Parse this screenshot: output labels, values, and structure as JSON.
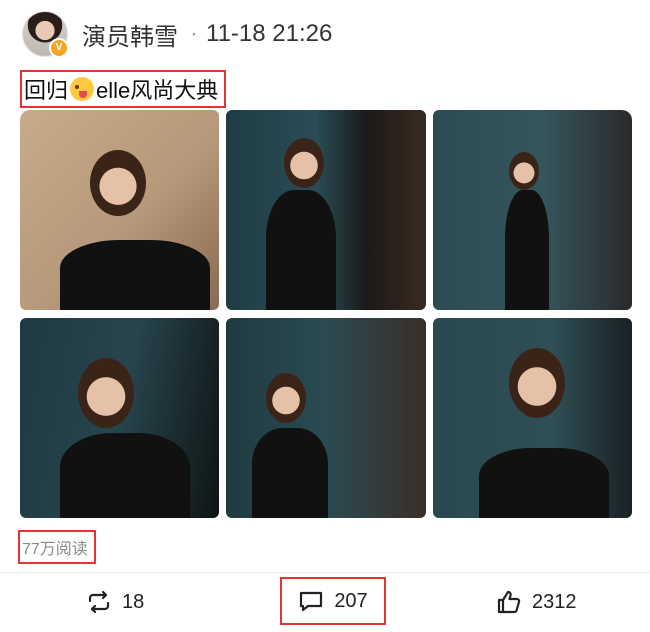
{
  "post": {
    "author": "演员韩雪",
    "verified_badge": "V",
    "separator": "·",
    "time": "11-18 21:26",
    "text_before_emoji": "回归",
    "emoji": "tongue-wink-emoji",
    "text_after_emoji": "elle风尚大典",
    "reads": "77万阅读"
  },
  "photos": [
    {
      "name": "photo-1"
    },
    {
      "name": "photo-2"
    },
    {
      "name": "photo-3"
    },
    {
      "name": "photo-4"
    },
    {
      "name": "photo-5"
    },
    {
      "name": "photo-6"
    }
  ],
  "actions": {
    "repost_count": "18",
    "comment_count": "207",
    "like_count": "2312"
  },
  "colors": {
    "highlight_box": "#e33434",
    "verified_badge": "#f5a623",
    "muted_text": "#8a8a8a"
  }
}
